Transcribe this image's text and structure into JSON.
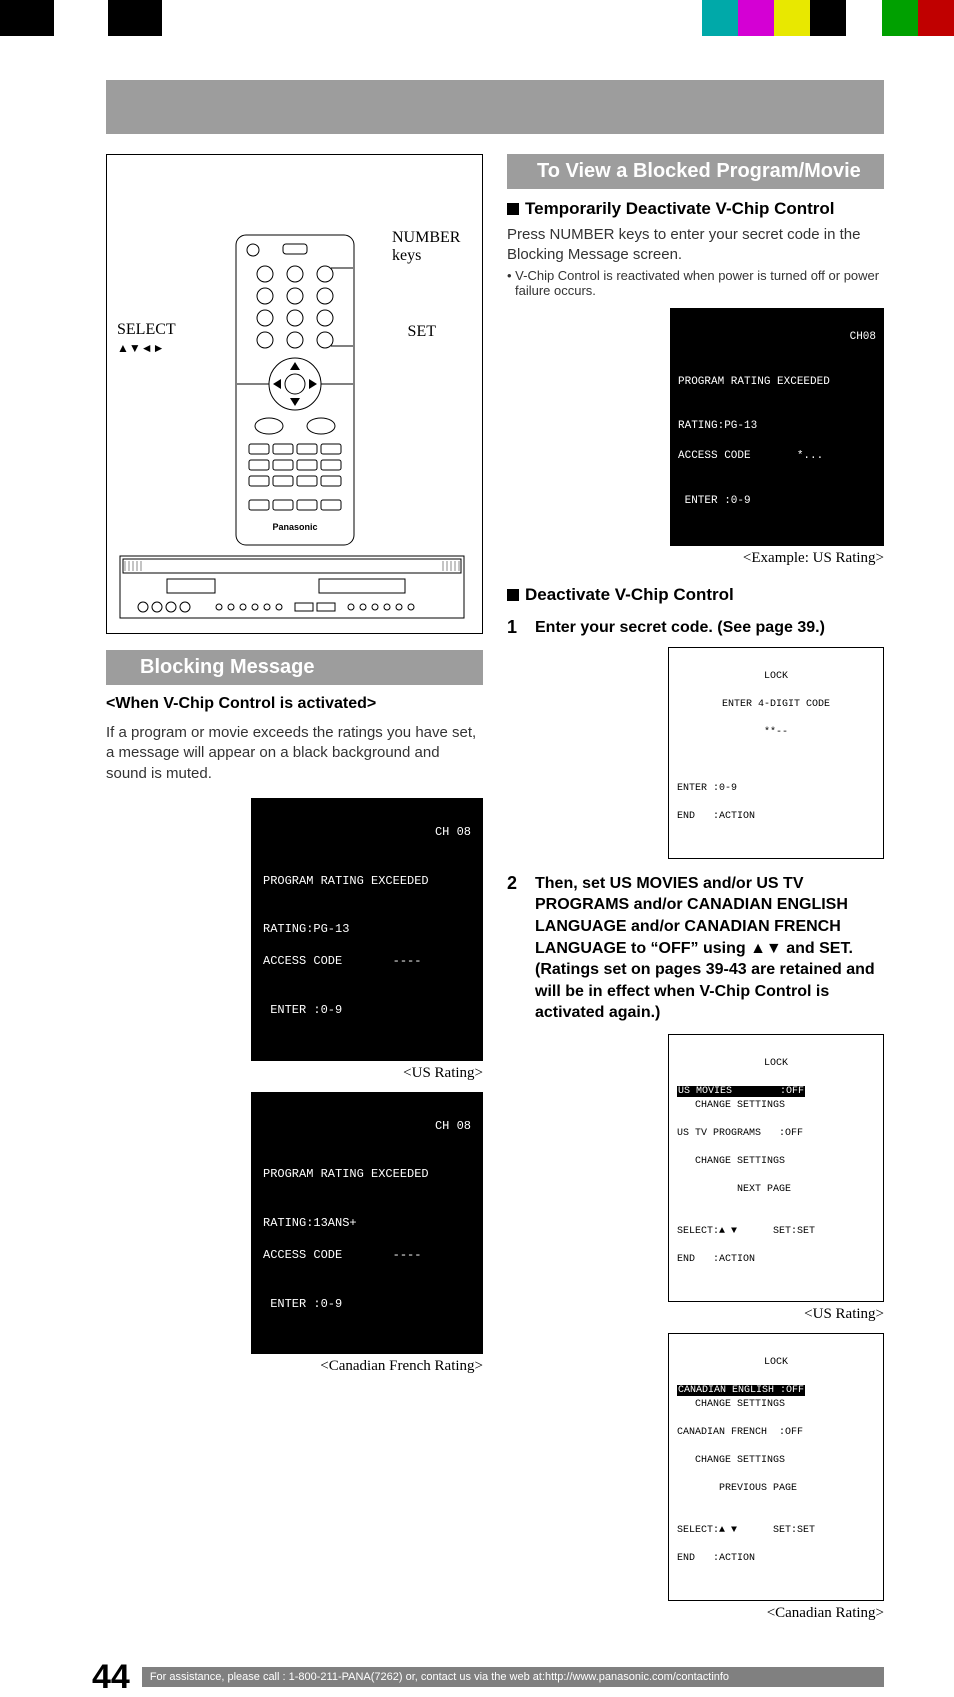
{
  "color_bar": {
    "left_widths": [
      54,
      54,
      54,
      54
    ],
    "left_colors": [
      "#000000",
      "#ffffff",
      "#000000",
      "#ffffff"
    ],
    "right_colors": [
      "#00a9a9",
      "#d400d4",
      "#e8e800",
      "#000000",
      "#ffffff",
      "#00a000",
      "#c00000"
    ]
  },
  "labels": {
    "select": "SELECT",
    "select_arrows": "▲▼◄►",
    "number": "NUMBER keys",
    "set": "SET"
  },
  "left": {
    "section_title": "Blocking Message",
    "subhead": "<When V-Chip Control is activated>",
    "paragraph": "If a program or movie exceeds the ratings you have set, a message will appear on a black background and sound is muted.",
    "osd_us": {
      "ch": "CH 08",
      "line1": "PROGRAM RATING EXCEEDED",
      "line2": "RATING:PG-13",
      "line3": "ACCESS CODE       ----",
      "line4": " ENTER :0-9"
    },
    "caption_us": "<US Rating>",
    "osd_ca": {
      "ch": "CH 08",
      "line1": "PROGRAM RATING EXCEEDED",
      "line2": "RATING:13ANS+",
      "line3": "ACCESS CODE       ----",
      "line4": " ENTER :0-9"
    },
    "caption_ca": "<Canadian French Rating>"
  },
  "right": {
    "section_title": "To View a Blocked Program/Movie",
    "h1": "Temporarily Deactivate V-Chip Control",
    "p1": "Press NUMBER keys to enter your secret code in the Blocking Message screen.",
    "note1": "• V-Chip Control is reactivated when power is turned off or power failure occurs.",
    "osd_ex": {
      "ch": "CH08",
      "line1": "PROGRAM RATING EXCEEDED",
      "line2": "RATING:PG-13",
      "line3": "ACCESS CODE       *...",
      "line4": " ENTER :0-9"
    },
    "caption_ex": "<Example: US Rating>",
    "h2": "Deactivate V-Chip Control",
    "step1": "Enter your secret code. (See page 39.)",
    "osd_lock": {
      "title": "LOCK",
      "line1": "ENTER 4-DIGIT CODE",
      "line2": "**--",
      "foot1": "ENTER :0-9",
      "foot2": "END   :ACTION"
    },
    "step2": "Then, set US MOVIES and/or US TV PROGRAMS and/or CANADIAN ENGLISH LANGUAGE and/or CANADIAN FRENCH LANGUAGE to “OFF” using ▲▼ and SET. (Ratings set on pages 39-43 are retained and will be in effect when V-Chip Control is activated again.)",
    "osd_us_menu": {
      "title": "LOCK",
      "hl": "US MOVIES        :OFF",
      "l1": "   CHANGE SETTINGS",
      "l2": "US TV PROGRAMS   :OFF",
      "l3": "   CHANGE SETTINGS",
      "l4": "          NEXT PAGE",
      "foot1": "SELECT:▲ ▼      SET:SET",
      "foot2": "END   :ACTION"
    },
    "caption_us_menu": "<US Rating>",
    "osd_ca_menu": {
      "title": "LOCK",
      "hl": "CANADIAN ENGLISH :OFF",
      "l1": "   CHANGE SETTINGS",
      "l2": "CANADIAN FRENCH  :OFF",
      "l3": "   CHANGE SETTINGS",
      "l4": "       PREVIOUS PAGE",
      "foot1": "SELECT:▲ ▼      SET:SET",
      "foot2": "END   :ACTION"
    },
    "caption_ca_menu": "<Canadian Rating>"
  },
  "footer": {
    "page": "44",
    "text": "For assistance, please call : 1-800-211-PANA(7262) or, contact us via the web at:http://www.panasonic.com/contactinfo"
  }
}
